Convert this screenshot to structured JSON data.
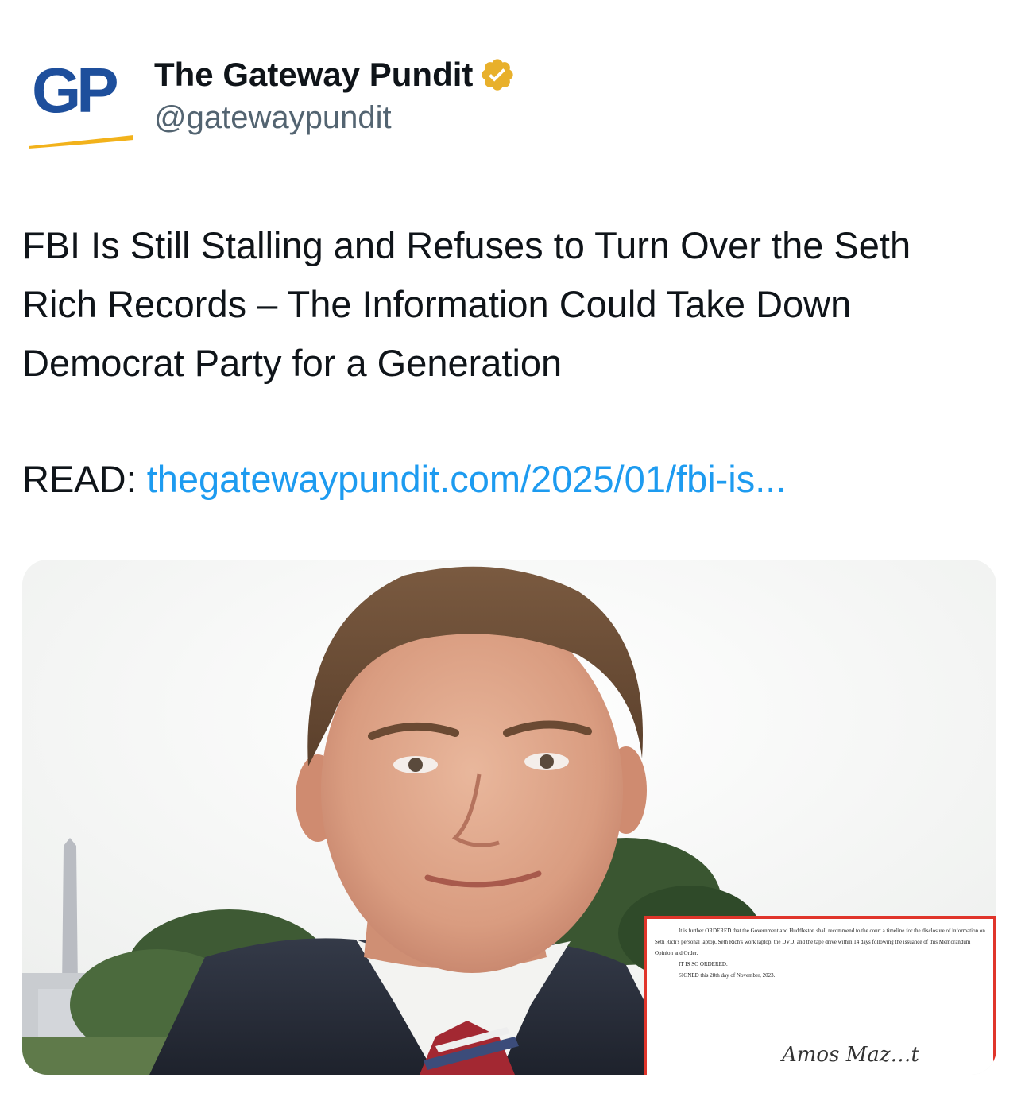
{
  "author": {
    "avatar_text": "GP",
    "display_name": "The Gateway Pundit",
    "verified_icon": "verified-gold-badge-icon",
    "handle": "@gatewaypundit"
  },
  "tweet": {
    "text": "FBI Is Still Stalling and Refuses to Turn Over the Seth Rich Records – The Information Could Take Down Democrat Party for a Generation",
    "read_prefix": "READ: ",
    "link_text": "thegatewaypundit.com/2025/01/fbi-is..."
  },
  "media": {
    "document_excerpt": {
      "paragraph": "It is further ORDERED that the Government and Huddleston shall recommend to the court a timeline for the disclosure of information on Seth Rich's personal laptop, Seth Rich's work laptop, the DVD, and the tape drive within 14 days following the issuance of this Memorandum Opinion and Order.",
      "ordered": "IT IS SO ORDERED.",
      "signed": "SIGNED this 28th day of November, 2023.",
      "signature": "Amos Mazzant"
    }
  },
  "colors": {
    "logo_blue": "#1e4f9c",
    "logo_gold": "#f2b21b",
    "verified_gold": "#e8b02b",
    "link_blue": "#1d9bf0",
    "text_primary": "#0f1419",
    "text_secondary": "#536471",
    "inset_border": "#e0352b"
  }
}
